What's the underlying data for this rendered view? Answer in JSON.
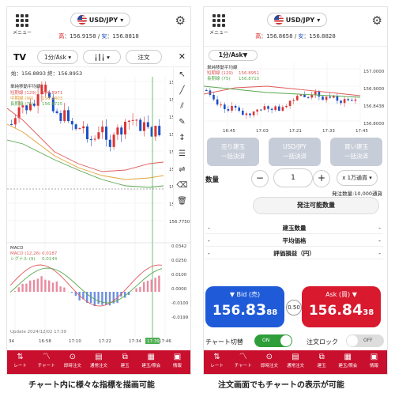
{
  "left": {
    "menu_label": "メニュー",
    "pair": "USD/JPY",
    "high_label": "高",
    "high": "156.9158",
    "low_label": "安",
    "low": "156.8818",
    "timeframe": "1分/Ask",
    "order_button": "注文",
    "ohlc": "始：156.8893 終：156.8953",
    "indicator_title": "単純移動平均線",
    "legend": [
      {
        "name": "短期線 (129)",
        "value": "156.8971",
        "color": "#e05a5a"
      },
      {
        "name": "中期線 (90)",
        "value": "156.8403",
        "color": "#e3a23a"
      },
      {
        "name": "長期線 (75)",
        "value": "156.8725",
        "color": "#5aa84f"
      }
    ],
    "price_ticks": [
      "156.9500",
      "156.9250",
      "156.9000",
      "156.8750",
      "156.8500",
      "156.8250",
      "156.8000",
      "156.7838",
      "156.7750"
    ],
    "macd_title": "MACD",
    "macd_legend": [
      {
        "name": "MACD (12,26)",
        "value": "0.0187",
        "color": "#e05a5a"
      },
      {
        "name": "シグナル (9)",
        "value": "0.0144",
        "color": "#5aa84f"
      }
    ],
    "macd_ticks": [
      "0.0342",
      "0.0250",
      "0.0100",
      "0.0000",
      "-0.0100",
      "-0.0199"
    ],
    "update_text": "Update 2024/12/02 17:39",
    "time_ticks": [
      "34",
      "16:58",
      "17:10",
      "17:22",
      "17:34",
      "17:46"
    ],
    "time_highlight": "17:39",
    "nav": [
      "レート",
      "チャート",
      "即時注文",
      "通常注文",
      "建玉",
      "建玉/照会",
      "情報"
    ]
  },
  "right": {
    "menu_label": "メニュー",
    "pair": "USD/JPY",
    "high_label": "高",
    "high": "156.8658",
    "low_label": "安",
    "low": "156.8828",
    "timeframe": "1分/Ask",
    "indicator_title": "単純移動平均線",
    "legend": [
      {
        "name": "短期線 (129)",
        "value": "156.8951",
        "color": "#e05a5a"
      },
      {
        "name": "長期線 (75)",
        "value": "156.8715",
        "color": "#5aa84f"
      }
    ],
    "price_ticks": [
      "157.0000",
      "156.9000",
      "156.8438",
      "156.8000"
    ],
    "time_ticks": [
      "16:45",
      "17:03",
      "17:21",
      "17:33",
      "17:45"
    ],
    "bulk_buttons": [
      {
        "l1": "売り建玉",
        "l2": "一括決済"
      },
      {
        "l1": "USD/JPY",
        "l2": "一括決済"
      },
      {
        "l1": "買い建玉",
        "l2": "一括決済"
      }
    ],
    "qty_label": "数量",
    "qty_value": "1",
    "minus": "−",
    "plus": "+",
    "unit": "x 1万通貨",
    "order_unit": "発注数量:10,000通貨",
    "available_button": "発注可能数量",
    "rows": [
      "建玉数量",
      "平均価格",
      "評価損益（円）"
    ],
    "bid_title": "▼ Bid (売)",
    "bid_a": "156.",
    "bid_b": "83",
    "bid_c": "88",
    "ask_title": "Ask (買) ▼",
    "ask_a": "156.",
    "ask_b": "84",
    "ask_c": "38",
    "spread": "0.50",
    "chart_toggle_label": "チャート切替",
    "chart_toggle": "ON",
    "order_lock_label": "注文ロック",
    "order_lock": "OFF",
    "nav": [
      "レート",
      "チャート",
      "即時注文",
      "通常注文",
      "建玉",
      "建玉/照会",
      "情報"
    ]
  },
  "captions": [
    "チャート内に様々な指標を描画可能",
    "注文画面でもチャートの表示が可能"
  ],
  "colors": {
    "brand_red": "#c8102e",
    "bid_blue": "#1f5bd8",
    "ask_red": "#d8192e",
    "toggle_green": "#2e9e3a"
  }
}
